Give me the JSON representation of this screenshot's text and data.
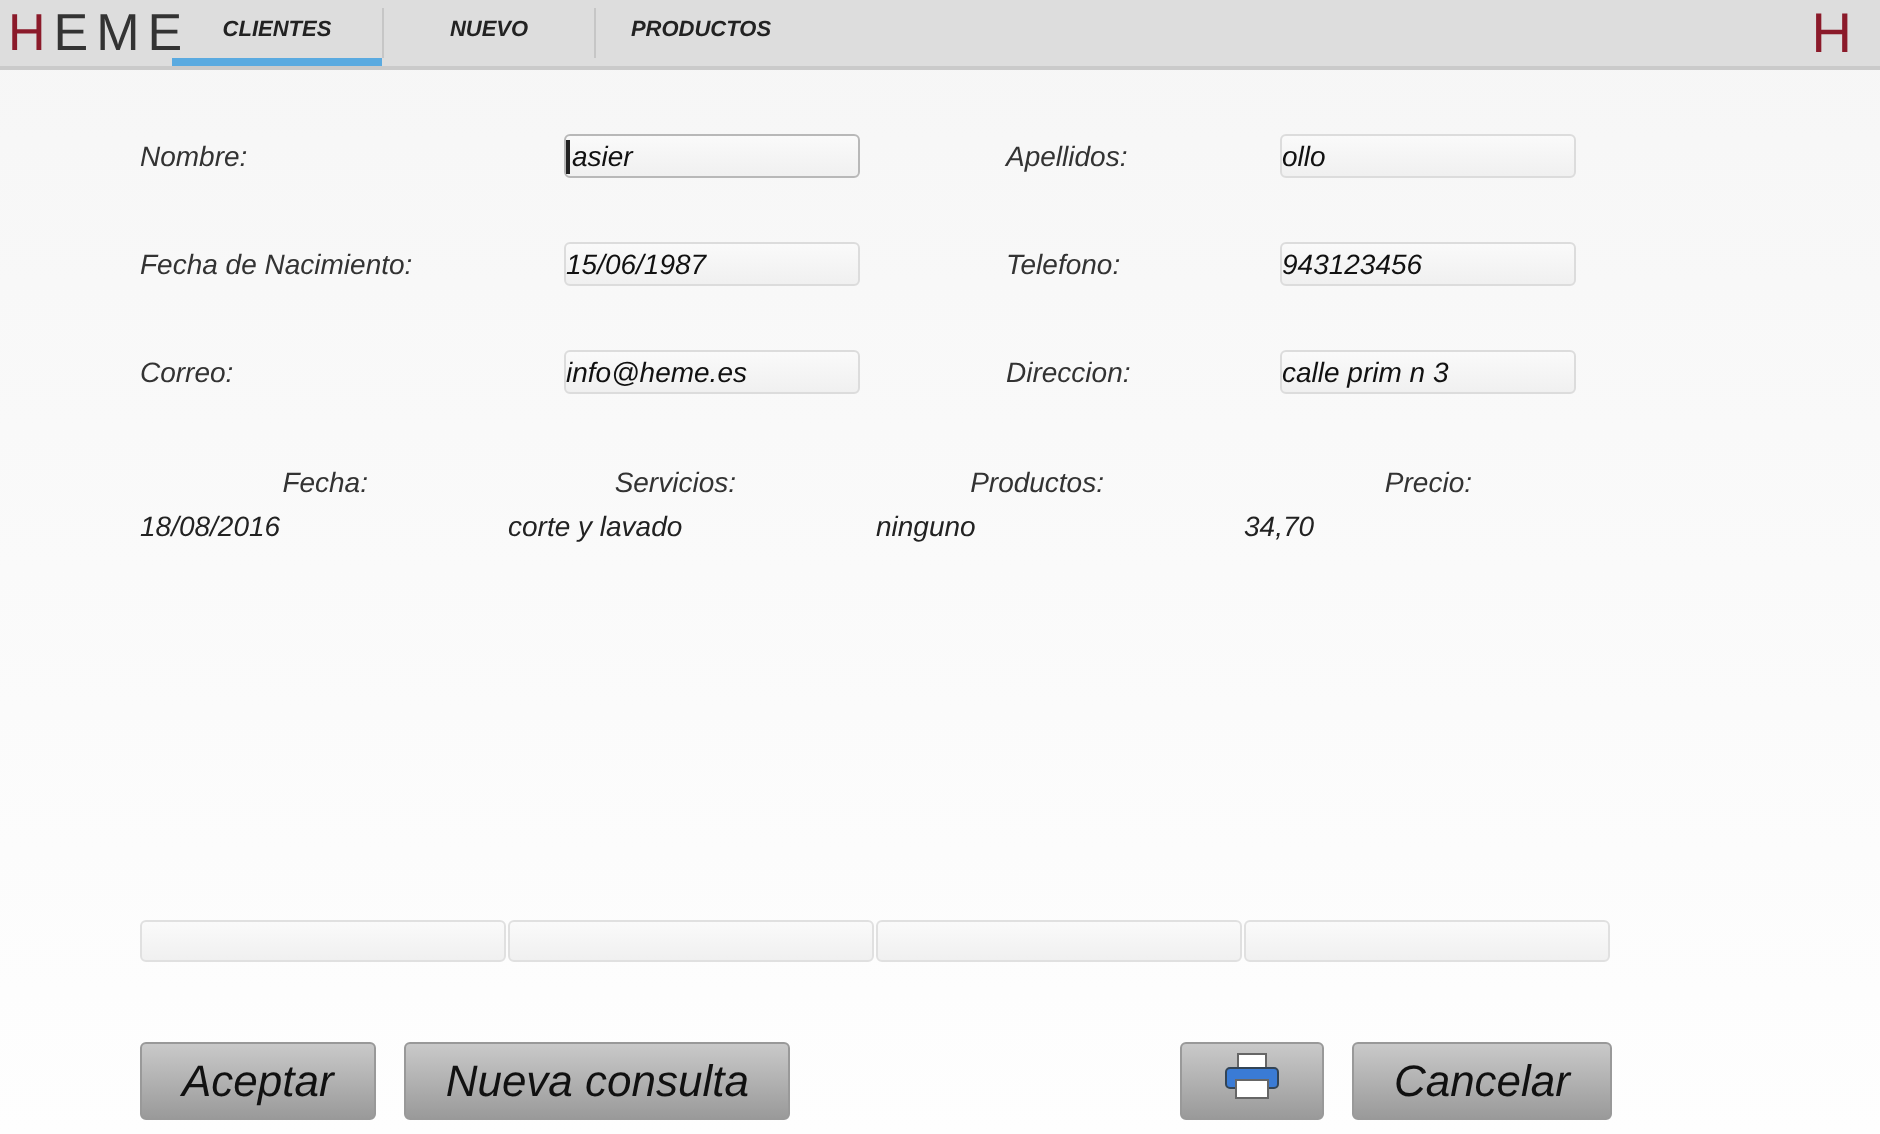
{
  "header": {
    "logo": {
      "accent": "H",
      "rest": "EME"
    },
    "tabs": [
      {
        "label": "CLIENTES",
        "selected": true
      },
      {
        "label": "NUEVO",
        "selected": false
      },
      {
        "label": "PRODUCTOS",
        "selected": false
      }
    ],
    "corner_letter": "H"
  },
  "form": [
    {
      "label": "Nombre:",
      "value": "asier",
      "focused": true
    },
    {
      "label": "Apellidos:",
      "value": "ollo",
      "focused": false
    },
    {
      "label": "Fecha de Nacimiento:",
      "value": "15/06/1987",
      "focused": false
    },
    {
      "label": "Telefono:",
      "value": "943123456",
      "focused": false
    },
    {
      "label": "Correo:",
      "value": "info@heme.es",
      "focused": false
    },
    {
      "label": "Direccion:",
      "value": "calle prim n 3",
      "focused": false
    }
  ],
  "history": {
    "columns": [
      "Fecha:",
      "Servicios:",
      "Productos:",
      "Precio:"
    ],
    "rows": [
      [
        "18/08/2016",
        "corte y lavado",
        "ninguno",
        "34,70"
      ]
    ]
  },
  "entry_row": [
    {
      "kind": "blank"
    },
    {
      "kind": "blank"
    },
    {
      "kind": "blank"
    },
    {
      "kind": "blank"
    }
  ],
  "buttons": [
    {
      "kind": "text",
      "label": "Aceptar"
    },
    {
      "kind": "text",
      "label": "Nueva consulta"
    },
    {
      "kind": "print"
    },
    {
      "kind": "text",
      "label": "Cancelar"
    }
  ]
}
